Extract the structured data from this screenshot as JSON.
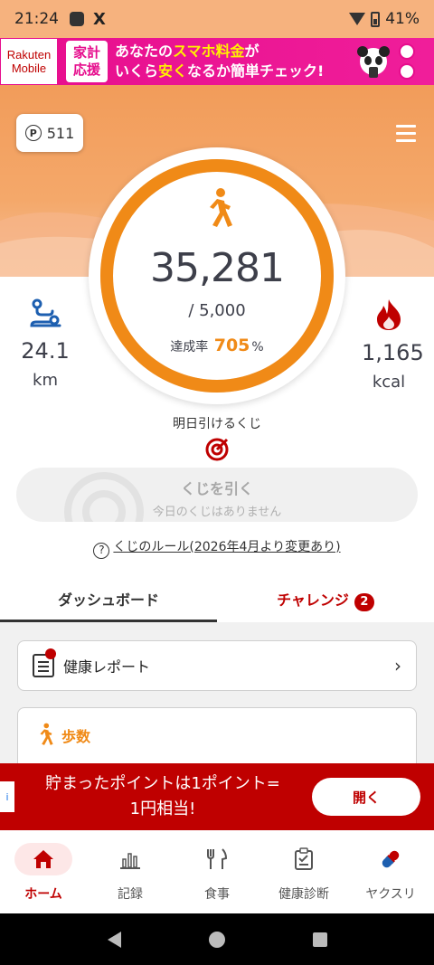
{
  "status_bar": {
    "time": "21:24",
    "x_app": "X",
    "battery": "41%"
  },
  "ad_banner": {
    "logo_line1": "Rakuten",
    "logo_line2": "Mobile",
    "tag_line1": "家計",
    "tag_line2": "応援",
    "text_part1": "あなたの",
    "text_highlight1": "スマホ料金",
    "text_part2": "が",
    "text_part3": "いくら",
    "text_highlight2": "安く",
    "text_part4": "なるか簡単チェック!"
  },
  "points": {
    "icon": "P",
    "value": "511"
  },
  "steps_ring": {
    "steps": "35,281",
    "goal": "/ 5,000",
    "rate_label": "達成率",
    "rate_value": "705",
    "rate_unit": "%",
    "progress": 1.0,
    "accent_color": "#f08a17"
  },
  "distance": {
    "value": "24.1",
    "unit": "km",
    "icon": "route-icon"
  },
  "calories": {
    "value": "1,165",
    "unit": "kcal",
    "icon": "flame-icon"
  },
  "kuji": {
    "label": "明日引けるくじ",
    "button_title": "くじを引く",
    "button_sub": "今日のくじはありません",
    "rules_link": "くじのルール(2026年4月より変更あり)"
  },
  "tabs": [
    {
      "label": "ダッシュボード"
    },
    {
      "label": "チャレンジ",
      "badge": "2"
    }
  ],
  "cards": {
    "report_label": "健康レポート",
    "steps_label": "歩数"
  },
  "promo": {
    "line1": "貯まったポイントは1ポイント=",
    "line2": "1円相当!",
    "button": "開く"
  },
  "bottom_nav": [
    {
      "label": "ホーム",
      "icon": "home-icon"
    },
    {
      "label": "記録",
      "icon": "chart-icon"
    },
    {
      "label": "食事",
      "icon": "cutlery-icon"
    },
    {
      "label": "健康診断",
      "icon": "clipboard-icon"
    },
    {
      "label": "ヤクスリ",
      "icon": "pill-icon"
    }
  ]
}
